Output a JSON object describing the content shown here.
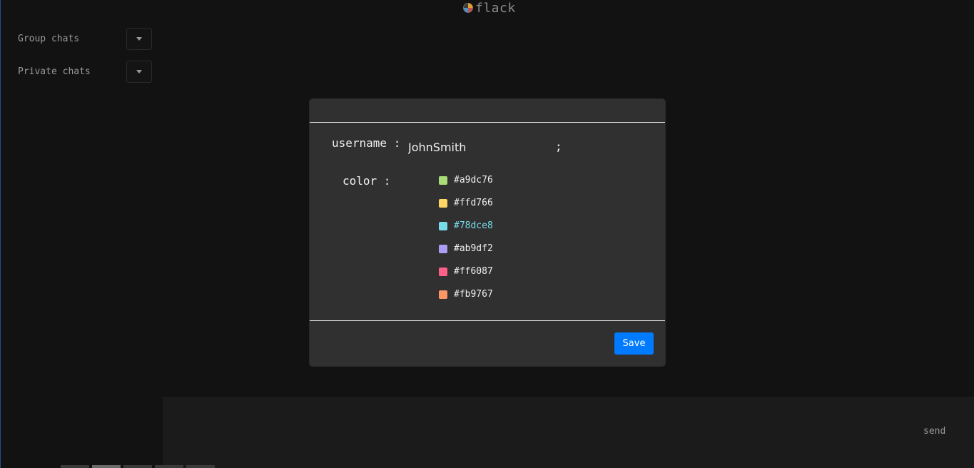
{
  "app": {
    "name": "flack",
    "logo_icon": "colored-circle-logo-icon"
  },
  "sidebar": {
    "items": [
      {
        "label": "Group chats",
        "toggle_icon": "caret-down-icon"
      },
      {
        "label": "Private chats",
        "toggle_icon": "caret-down-icon"
      }
    ]
  },
  "composer": {
    "send_label": "send"
  },
  "modal": {
    "username_label": "username :",
    "username_value": "JohnSmith",
    "username_terminator": ";",
    "color_label": "color :",
    "colors": [
      {
        "name": "#a9dc76",
        "hex": "#a9dc76",
        "selected": false
      },
      {
        "name": "#ffd766",
        "hex": "#ffd766",
        "selected": false
      },
      {
        "name": "#78dce8",
        "hex": "#78dce8",
        "selected": true
      },
      {
        "name": "#ab9df2",
        "hex": "#ab9df2",
        "selected": false
      },
      {
        "name": "#ff6087",
        "hex": "#ff6087",
        "selected": false
      },
      {
        "name": "#fb9767",
        "hex": "#fb9767",
        "selected": false
      }
    ],
    "save_label": "Save"
  },
  "theme": {
    "background": "#121212",
    "panel": "#303030",
    "accent": "#007bff"
  }
}
